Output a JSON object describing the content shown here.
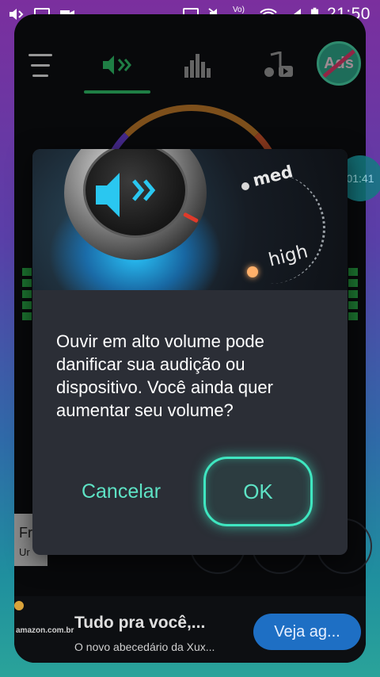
{
  "status_bar": {
    "time": "21:50",
    "network_label": "Vo) LTE",
    "left_icons": [
      "volume-icon",
      "cast-icon",
      "video-icon"
    ],
    "right_icons": [
      "cast-icon",
      "mute-icon",
      "lte-icon",
      "wifi-icon",
      "signal-icon",
      "battery-icon"
    ]
  },
  "top_nav": {
    "tabs": [
      {
        "name": "menu-icon"
      },
      {
        "name": "volume-boost-icon",
        "active": true
      },
      {
        "name": "equalizer-icon"
      },
      {
        "name": "music-video-icon"
      }
    ],
    "ads_badge": "Ads",
    "accent_color": "#31c26b"
  },
  "timer_bubble": "01:41",
  "background_cards": {
    "card_title": "Fr",
    "card_sub": "Ur"
  },
  "dialog": {
    "labels": {
      "med": "med",
      "high": "high"
    },
    "message": "Ouvir em alto volume pode danificar sua audição ou dispositivo. Você ainda quer aumentar seu volume?",
    "cancel_label": "Cancelar",
    "ok_label": "OK",
    "accent_color": "#3fe6c0"
  },
  "ad_banner": {
    "brand": "amazon.com.br",
    "title": "Tudo pra você,...",
    "description": "O novo abecedário da Xux...",
    "cta": "Veja ag..."
  }
}
